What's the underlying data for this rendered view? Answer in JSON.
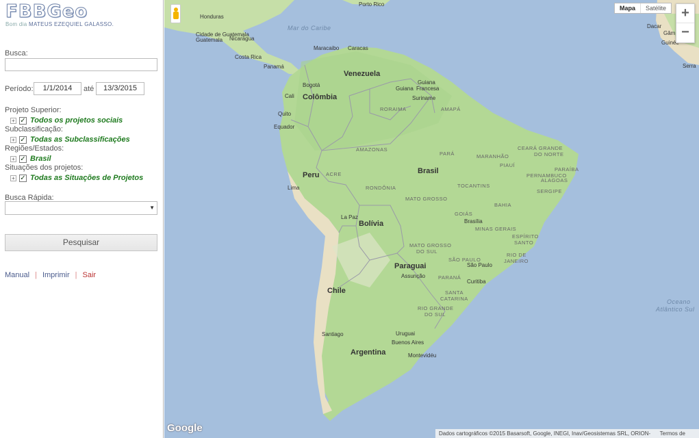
{
  "app": {
    "logo": "FBBGeo"
  },
  "greeting": {
    "prefix": "Bom dia",
    "user": "MATEUS EZEQUIEL GALASSO."
  },
  "form": {
    "search_label": "Busca:",
    "search_value": "",
    "period_label": "Período:",
    "date_start": "1/1/2014",
    "date_sep": "até",
    "date_end": "13/3/2015",
    "filters": [
      {
        "label": "Projeto Superior:",
        "item": "Todos os projetos sociais",
        "checked": true
      },
      {
        "label": "Subclassificação:",
        "item": "Todas as Subclassificações",
        "checked": true
      },
      {
        "label": "Regiões/Estados:",
        "item": "Brasil",
        "checked": true
      },
      {
        "label": "Situações dos projetos:",
        "item": "Todas as Situações de Projetos",
        "checked": true
      }
    ],
    "quick_search_label": "Busca Rápida:",
    "quick_search_value": "",
    "submit_label": "Pesquisar"
  },
  "links": {
    "manual": "Manual",
    "print": "Imprimir",
    "logout": "Sair"
  },
  "icons": {
    "expand": "plus-box-icon",
    "check": "checkbox-checked-icon",
    "dropdown": "triangle-down-icon",
    "pegman": "pegman-icon"
  },
  "map": {
    "type_buttons": {
      "map": "Mapa",
      "satellite": "Satélite"
    },
    "zoom_in": "+",
    "zoom_out": "−",
    "brand": "Google",
    "attribution": "Dados cartográficos ©2015 Basarsoft, Google, INEGI, Inav/Geosistemas SRL, ORION-ME",
    "terms": "Termos de Uso",
    "countries": {
      "venezuela": "Venezuela",
      "colombia": "Colômbia",
      "brasil": "Brasil",
      "peru": "Peru",
      "bolivia": "Bolívia",
      "paraguai": "Paraguai",
      "chile": "Chile",
      "argentina": "Argentina",
      "uruguai": "Uruguai",
      "guiana": "Guiana",
      "suriname": "Suriname",
      "guiana_fr": "Guiana Francesa",
      "equador": "Equador",
      "nicaragua": "Nicarágua",
      "honduras": "Honduras",
      "costa_rica": "Costa Rica",
      "panama": "Panamá",
      "guatemala": "Cidade de Guatemala"
    },
    "states": {
      "roraima": "RORAIMA",
      "amapa": "AMAPÁ",
      "amazonas": "AMAZONAS",
      "para": "PARÁ",
      "maranhao": "MARANHÃO",
      "ceara": "CEARÁ GRANDE",
      "ceara2": "DO NORTE",
      "piaui": "PIAUÍ",
      "paraiba": "PARAÍBA",
      "pernambuco": "PERNAMBUCO",
      "alagoas": "ALAGOAS",
      "sergipe": "SERGIPE",
      "acre": "ACRE",
      "rondonia": "RONDÔNIA",
      "tocantins": "TOCANTINS",
      "matogrosso": "MATO GROSSO",
      "goias": "GOIÁS",
      "minas": "MINAS GERAIS",
      "bahia": "BAHIA",
      "espirito": "ESPÍRITO",
      "espirito2": "SANTO",
      "msul": "MATO GROSSO",
      "msul2": "DO SUL",
      "sp": "SÃO PAULO",
      "rj": "RIO DE",
      "rj2": "JANEIRO",
      "parana": "PARANÁ",
      "sc": "SANTA",
      "sc2": "CATARINA",
      "rs": "RIO GRANDE",
      "rs2": "DO SUL"
    },
    "cities": {
      "portorico": "Porto Rico",
      "maracaibo": "Maracaibo",
      "caracas": "Caracas",
      "bogota": "Bogotá",
      "cali": "Cali",
      "quito": "Quito",
      "lima": "Lima",
      "lapaz": "La Paz",
      "brasilia": "Brasília",
      "saopaulo": "São Paulo",
      "asuncion": "Assunção",
      "curitiba": "Curitiba",
      "santiago": "Santiago",
      "buenosaires": "Buenos Aires",
      "montevideo": "Montevidéu",
      "dacar": "Dacar",
      "gambia": "Gâm",
      "guine": "Guinée",
      "serra": "Serra"
    },
    "oceans": {
      "caribe": "Mar do Caribe",
      "atlantico": "Oceano",
      "atlantico2": "Atlântico Sul"
    }
  }
}
